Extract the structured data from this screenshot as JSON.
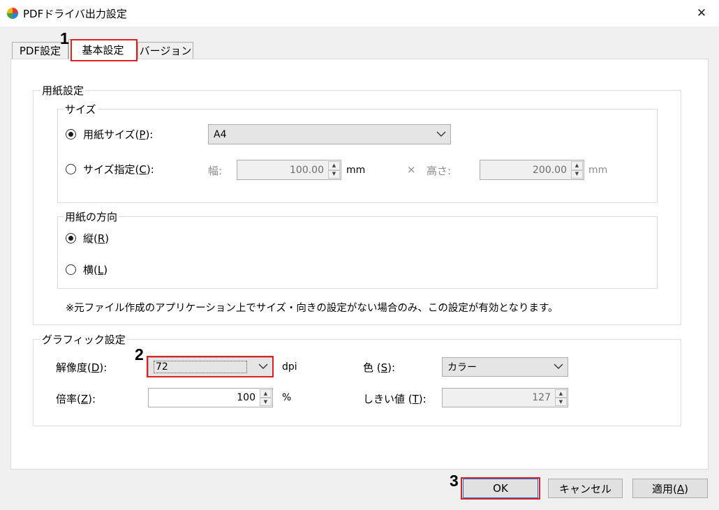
{
  "window": {
    "title": "PDFドライバ出力設定",
    "close_glyph": "✕"
  },
  "tabs": [
    {
      "label": "PDF設定",
      "selected": false
    },
    {
      "label": "基本設定",
      "selected": true
    },
    {
      "label": "バージョン",
      "selected": false
    }
  ],
  "paper_group": {
    "title": "用紙設定",
    "size_group": {
      "title": "サイズ",
      "paper_size_radio": {
        "label": "用紙サイズ(",
        "key": "P",
        "suffix": "):",
        "checked": true
      },
      "paper_size_select": {
        "value": "A4"
      },
      "custom_size_radio": {
        "label": "サイズ指定(",
        "key": "C",
        "suffix": "):",
        "checked": false
      },
      "width_label": "幅:",
      "width_value": "100.00",
      "width_unit": "mm",
      "times_sign": "×",
      "height_label": "高さ:",
      "height_value": "200.00",
      "height_unit": "mm"
    },
    "orientation_group": {
      "title": "用紙の方向",
      "portrait": {
        "label": "縦(",
        "key": "R",
        "suffix": ")",
        "checked": true
      },
      "landscape": {
        "label": "横(",
        "key": "L",
        "suffix": ")",
        "checked": false
      }
    },
    "note": "※元ファイル作成のアプリケーション上でサイズ・向きの設定がない場合のみ、この設定が有効となります。"
  },
  "graphic_group": {
    "title": "グラフィック設定",
    "resolution": {
      "label": "解像度(",
      "key": "D",
      "suffix": "):",
      "value": "72",
      "unit": "dpi"
    },
    "color": {
      "label": "色 (",
      "key": "S",
      "suffix": "):",
      "value": "カラー"
    },
    "scale": {
      "label": "倍率(",
      "key": "Z",
      "suffix": "):",
      "value": "100",
      "unit": "%"
    },
    "threshold": {
      "label": "しきい値 (",
      "key": "T",
      "suffix": "):",
      "value": "127"
    }
  },
  "buttons": {
    "ok": "OK",
    "cancel": "キャンセル",
    "apply_label": "適用(",
    "apply_key": "A",
    "apply_suffix": ")"
  },
  "annotations": {
    "step1": "1",
    "step2": "2",
    "step3": "3",
    "highlight_color": "#e02020"
  }
}
